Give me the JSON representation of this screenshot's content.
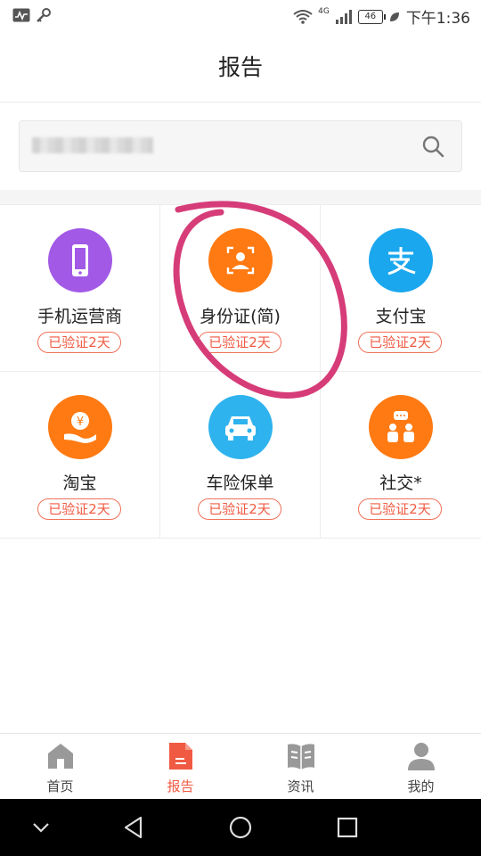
{
  "status_bar": {
    "time": "下午1:36",
    "battery": "46",
    "network": "4G"
  },
  "header": {
    "title": "报告"
  },
  "search": {
    "placeholder": ""
  },
  "tiles": [
    {
      "name": "手机运营商",
      "badge": "已验证2天",
      "icon": "phone-icon",
      "color": "#a259e6"
    },
    {
      "name": "身份证(简)",
      "badge": "已验证2天",
      "icon": "id-card-icon",
      "color": "#ff7a12"
    },
    {
      "name": "支付宝",
      "badge": "已验证2天",
      "icon": "alipay-icon",
      "color": "#1aa7ee"
    },
    {
      "name": "淘宝",
      "badge": "已验证2天",
      "icon": "taobao-coin-icon",
      "color": "#ff7a12"
    },
    {
      "name": "车险保单",
      "badge": "已验证2天",
      "icon": "car-icon",
      "color": "#2fb3ee"
    },
    {
      "name": "社交*",
      "badge": "已验证2天",
      "icon": "social-icon",
      "color": "#ff7a12"
    }
  ],
  "annotation_color": "#d63c78",
  "bottom_nav": [
    {
      "label": "首页",
      "icon": "home-icon",
      "active": false
    },
    {
      "label": "报告",
      "icon": "report-icon",
      "active": true
    },
    {
      "label": "资讯",
      "icon": "news-icon",
      "active": false
    },
    {
      "label": "我的",
      "icon": "profile-icon",
      "active": false
    }
  ],
  "system_nav": [
    "chevron-down-icon",
    "back-icon",
    "home-circle-icon",
    "recents-icon"
  ],
  "accent_color": "#f05a42"
}
